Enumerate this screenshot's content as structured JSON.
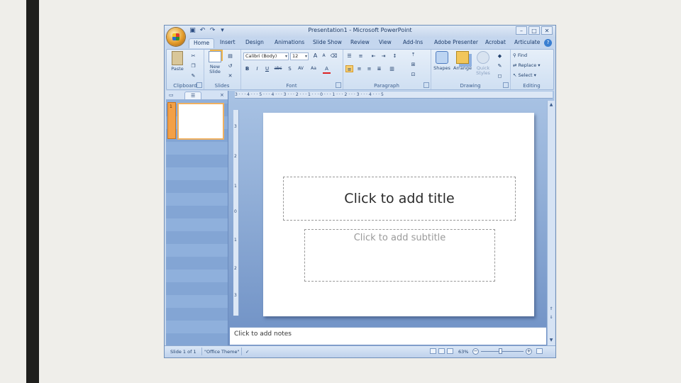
{
  "window": {
    "title": "Presentation1 - Microsoft PowerPoint",
    "controls": {
      "minimize": "–",
      "restore": "□",
      "close": "✕"
    }
  },
  "quick_access": [
    "save-icon",
    "undo-icon",
    "redo-icon",
    "customize-icon"
  ],
  "tabs": [
    {
      "label": "Home",
      "active": true
    },
    {
      "label": "Insert"
    },
    {
      "label": "Design"
    },
    {
      "label": "Animations"
    },
    {
      "label": "Slide Show"
    },
    {
      "label": "Review"
    },
    {
      "label": "View"
    },
    {
      "label": "Add-Ins"
    },
    {
      "label": "Adobe Presenter"
    },
    {
      "label": "Acrobat"
    },
    {
      "label": "Articulate"
    }
  ],
  "ribbon": {
    "clipboard": {
      "label": "Clipboard",
      "paste": "Paste"
    },
    "slides": {
      "label": "Slides",
      "new_slide_1": "New",
      "new_slide_2": "Slide"
    },
    "font": {
      "label": "Font",
      "family": "Calibri (Body)",
      "size": "12",
      "grow": "A",
      "shrink": "A",
      "clear": "⌫",
      "bold": "B",
      "italic": "I",
      "underline": "U",
      "strike": "abc",
      "shadow": "S",
      "spacing": "AV",
      "case": "Aa",
      "color": "A"
    },
    "paragraph": {
      "label": "Paragraph"
    },
    "drawing": {
      "label": "Drawing",
      "shapes": "Shapes",
      "arrange": "Arrange",
      "quick_styles_1": "Quick",
      "quick_styles_2": "Styles"
    },
    "editing": {
      "label": "Editing",
      "find": "Find",
      "replace": "Replace",
      "select": "Select"
    }
  },
  "pane": {
    "slide_number": "1"
  },
  "ruler_text": "3 · · · 4 · · · 5 · · · 4 · · · 3 · · · 2 · · · 1 · · · 0 · · · 1 · · · 2 · · · 3 · · · 4 · · · 5",
  "ruler_v": [
    "3",
    "2",
    "1",
    "0",
    "1",
    "2",
    "3"
  ],
  "slide": {
    "title_placeholder": "Click to add title",
    "subtitle_placeholder": "Click to add subtitle"
  },
  "notes": {
    "placeholder": "Click to add notes"
  },
  "status": {
    "slide": "Slide 1 of 1",
    "theme": "\"Office Theme\"",
    "zoom": "63%",
    "zoom_fraction": 0.45
  }
}
